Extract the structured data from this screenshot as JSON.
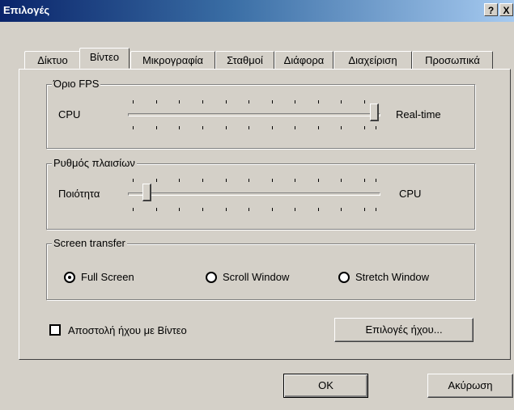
{
  "window": {
    "title": "Επιλογές",
    "help_label": "?",
    "close_label": "X"
  },
  "tabs": [
    {
      "label": "Δίκτυο"
    },
    {
      "label": "Βίντεο",
      "active": true
    },
    {
      "label": "Μικρογραφία"
    },
    {
      "label": "Σταθμοί"
    },
    {
      "label": "Διάφορα"
    },
    {
      "label": "Διαχείριση"
    },
    {
      "label": "Προσωπικά"
    }
  ],
  "fps_group": {
    "title": "Όριο FPS",
    "left_label": "CPU",
    "right_label": "Real-time",
    "slider_value": 1.0
  },
  "frame_rate_group": {
    "title": "Ρυθμός πλαισίων",
    "left_label": "Ποιότητα",
    "right_label": "CPU",
    "slider_value": 0.1
  },
  "screen_transfer_group": {
    "title": "Screen transfer",
    "options": [
      {
        "label": "Full Screen",
        "selected": true
      },
      {
        "label": "Scroll Window",
        "selected": false
      },
      {
        "label": "Stretch Window",
        "selected": false
      }
    ]
  },
  "send_audio": {
    "label": "Αποστολή ήχου με Βίντεο",
    "checked": false
  },
  "audio_options_button": "Επιλογές ήχου...",
  "ok_button": "OK",
  "cancel_button": "Ακύρωση"
}
